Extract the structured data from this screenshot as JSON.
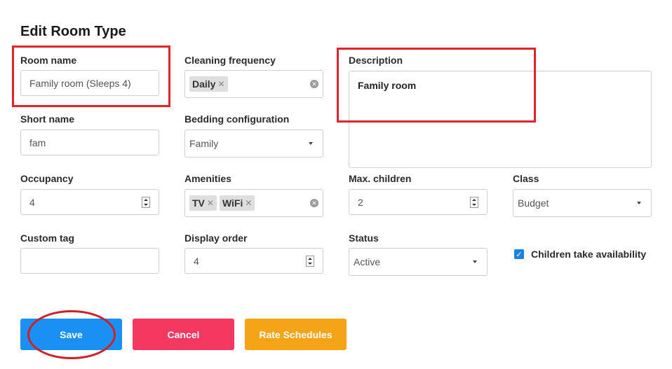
{
  "page": {
    "title": "Edit Room Type"
  },
  "form": {
    "room_name": {
      "label": "Room name",
      "value": "Family room (Sleeps 4)"
    },
    "short_name": {
      "label": "Short name",
      "value": "fam"
    },
    "occupancy": {
      "label": "Occupancy",
      "value": "4"
    },
    "custom_tag": {
      "label": "Custom tag",
      "value": ""
    },
    "cleaning_frequency": {
      "label": "Cleaning frequency",
      "tags": [
        "Daily"
      ]
    },
    "bedding_configuration": {
      "label": "Bedding configuration",
      "value": "Family"
    },
    "amenities": {
      "label": "Amenities",
      "tags": [
        "TV",
        "WiFi"
      ]
    },
    "display_order": {
      "label": "Display order",
      "value": "4"
    },
    "description": {
      "label": "Description",
      "value": "Family room"
    },
    "max_children": {
      "label": "Max. children",
      "value": "2"
    },
    "status": {
      "label": "Status",
      "value": "Active"
    },
    "class": {
      "label": "Class",
      "value": "Budget"
    },
    "children_take_availability": {
      "label": "Children take availability",
      "checked": true
    }
  },
  "buttons": {
    "save": {
      "label": "Save",
      "color": "#1a90f5"
    },
    "cancel": {
      "label": "Cancel",
      "color": "#f5385f"
    },
    "rate_schedules": {
      "label": "Rate Schedules",
      "color": "#f5a418"
    }
  },
  "annotation_color": "#e0242e"
}
